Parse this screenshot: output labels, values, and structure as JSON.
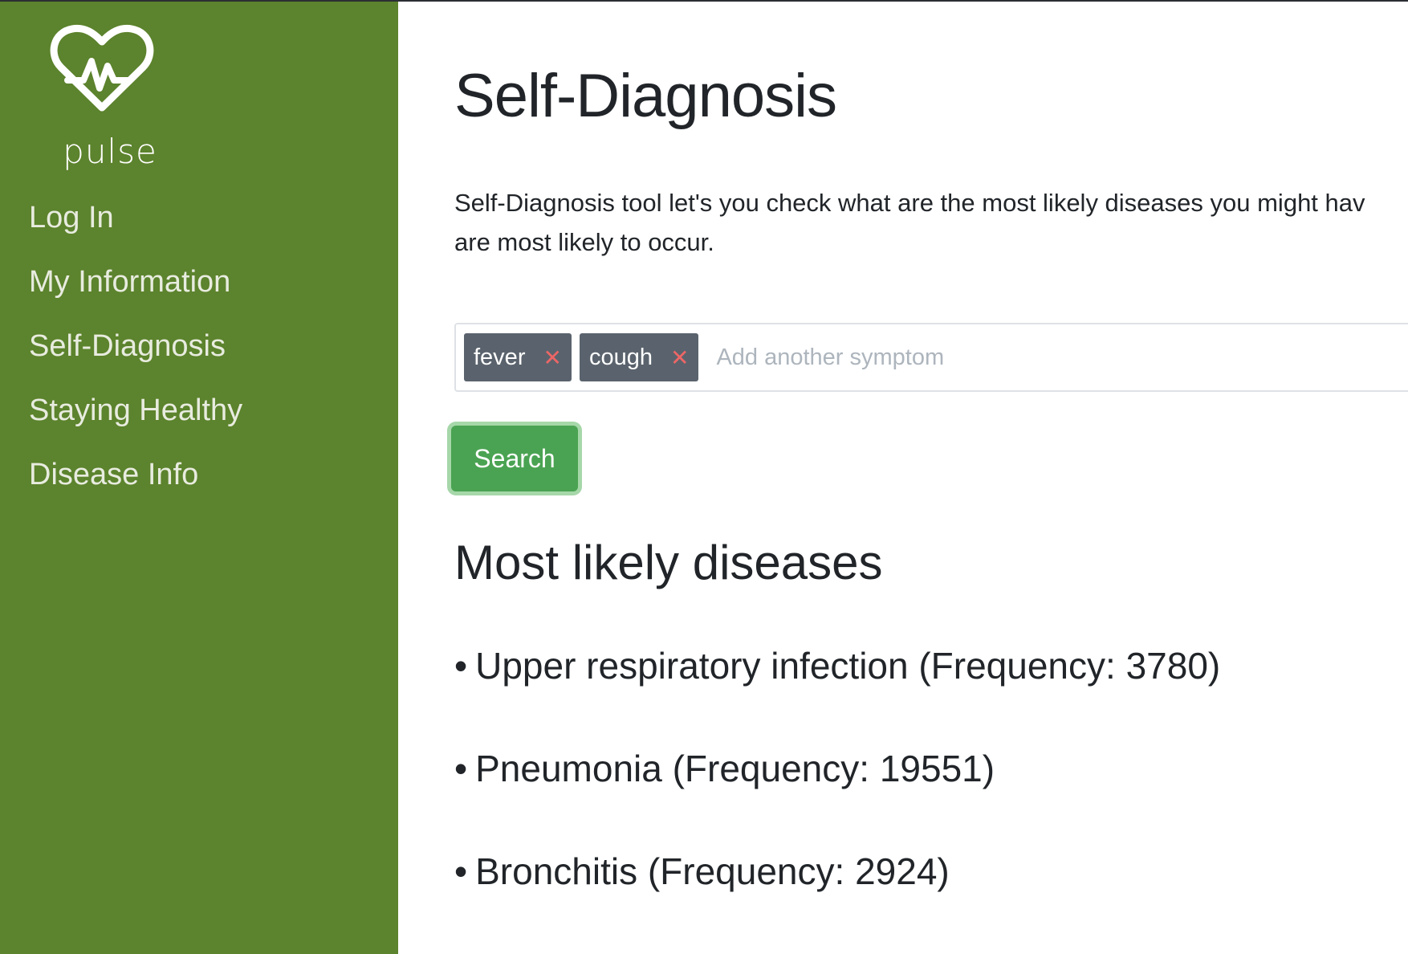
{
  "brand": {
    "logo_icon": "heart-pulse-icon",
    "name": "pulse",
    "color": "#5c832d"
  },
  "nav": {
    "items": [
      {
        "label": "Log In"
      },
      {
        "label": "My Information"
      },
      {
        "label": "Self-Diagnosis"
      },
      {
        "label": "Staying Healthy"
      },
      {
        "label": "Disease Info"
      }
    ]
  },
  "page": {
    "title": "Self-Diagnosis",
    "description_line1": "Self-Diagnosis tool let's you check what are the most likely diseases you might hav",
    "description_line2": "are most likely to occur."
  },
  "symptoms": {
    "tags": [
      {
        "label": "fever",
        "remove_icon": "close-icon"
      },
      {
        "label": "cough",
        "remove_icon": "close-icon"
      }
    ],
    "placeholder": "Add another symptom",
    "value": ""
  },
  "search": {
    "label": "Search",
    "color": "#4aa352"
  },
  "results": {
    "heading": "Most likely diseases",
    "bullet": "•",
    "items": [
      {
        "text": "Upper respiratory infection (Frequency: 3780)"
      },
      {
        "text": "Pneumonia (Frequency: 19551)"
      },
      {
        "text": "Bronchitis (Frequency: 2924)"
      }
    ]
  }
}
